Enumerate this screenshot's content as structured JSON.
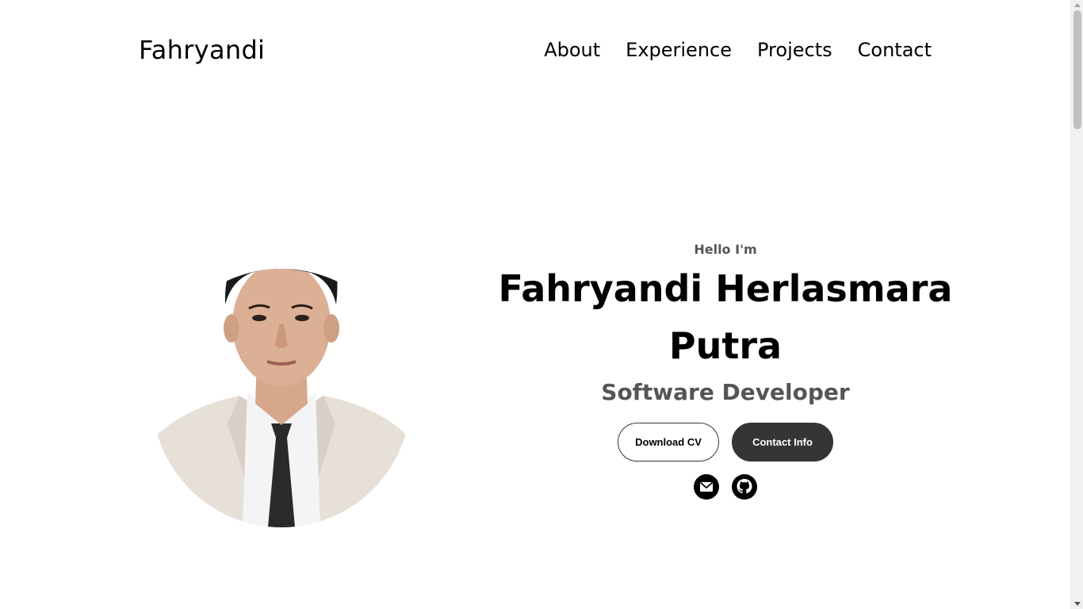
{
  "header": {
    "logo": "Fahryandi",
    "nav": [
      {
        "label": "About"
      },
      {
        "label": "Experience"
      },
      {
        "label": "Projects"
      },
      {
        "label": "Contact"
      }
    ]
  },
  "hero": {
    "greeting": "Hello I'm",
    "name": "Fahryandi Herlasmara Putra",
    "role": "Software Developer",
    "buttons": {
      "download_cv": "Download CV",
      "contact_info": "Contact Info"
    },
    "social_icons": [
      "email-icon",
      "github-icon"
    ]
  },
  "colors": {
    "text": "#000000",
    "muted_text": "#555555",
    "button_dark": "#353535",
    "background": "#ffffff"
  }
}
